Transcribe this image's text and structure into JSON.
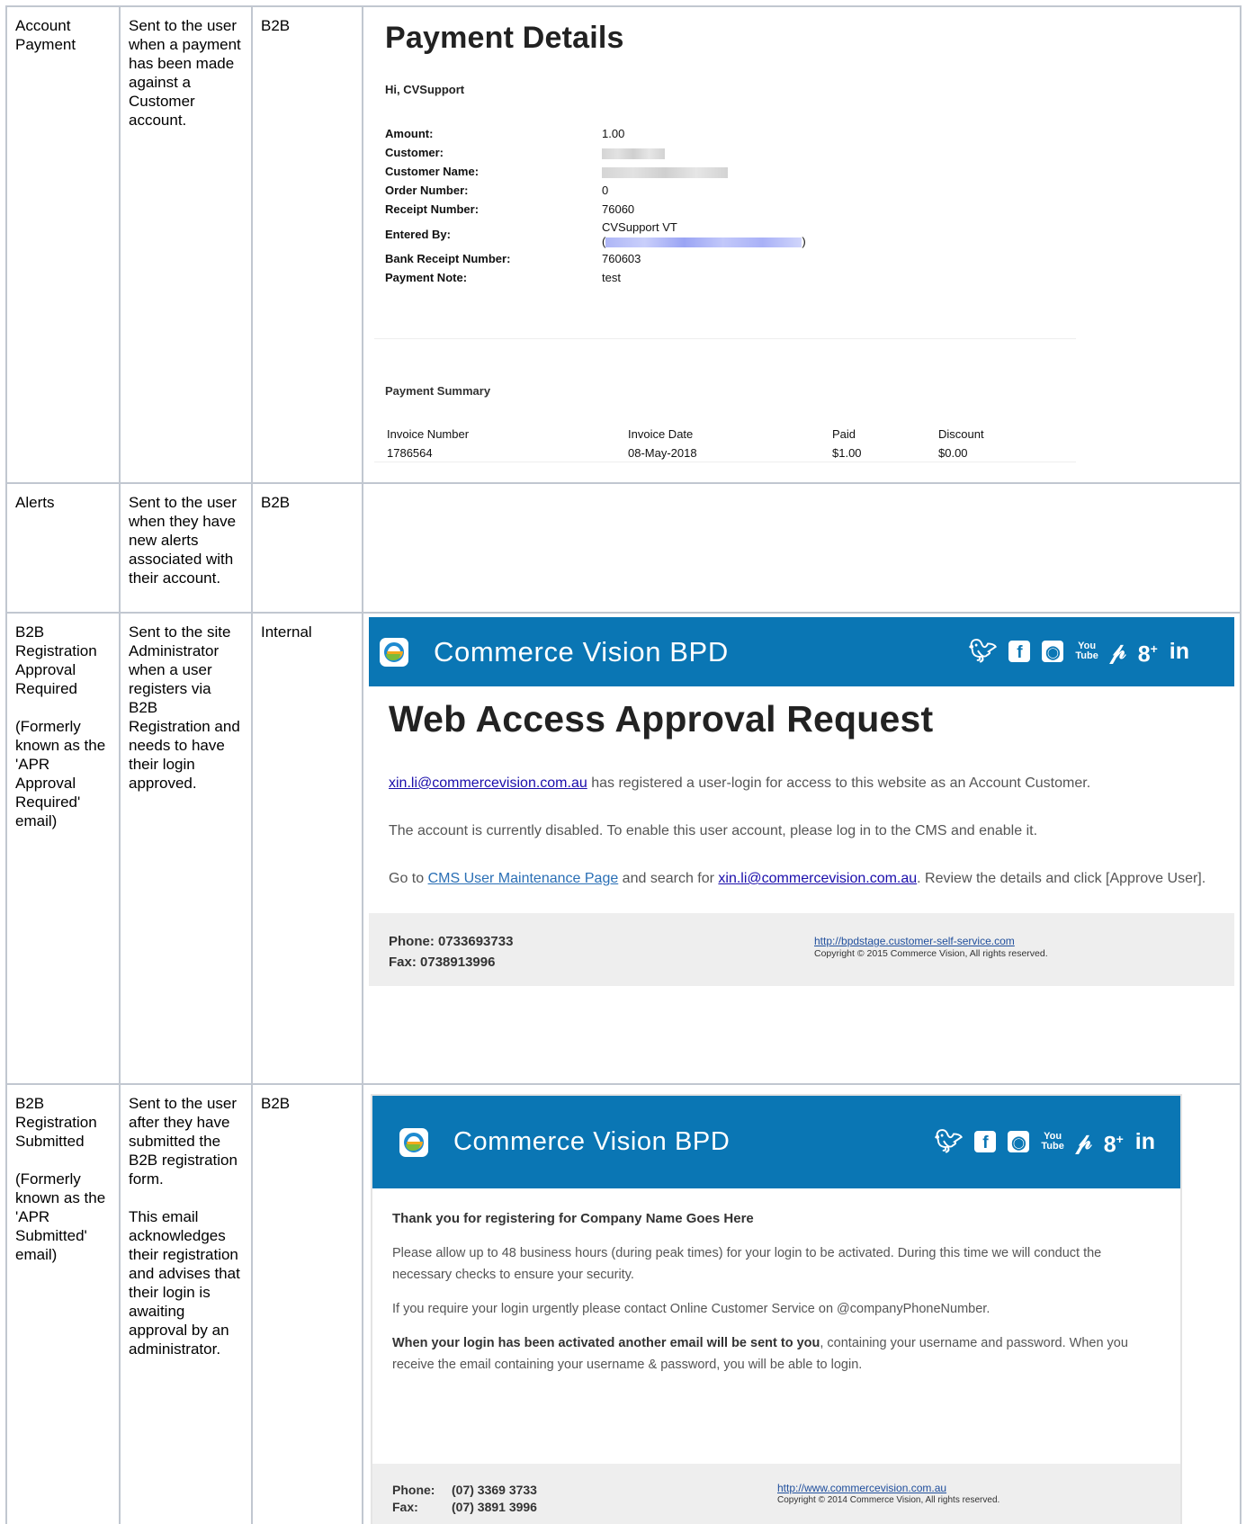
{
  "rows": [
    {
      "name": [
        "Account",
        "Payment"
      ],
      "description": "Sent to the user when a payment has been made against a Customer account.",
      "type": "B2B"
    },
    {
      "name": [
        "Alerts"
      ],
      "description": "Sent to the user when they have new alerts associated with their account.",
      "type": "B2B"
    },
    {
      "name": [
        "B2B Registration Approval Required",
        "(Formerly known as the 'APR Approval Required' email)"
      ],
      "description": "Sent to the site Administrator when a user registers via B2B Registration and needs to have their login approved.",
      "type": "Internal"
    },
    {
      "name": [
        "B2B Registration Submitted",
        "(Formerly known as the 'APR Submitted' email)"
      ],
      "description": [
        "Sent to the user after they have submitted the B2B registration form.",
        "This email acknowledges their registration and advises that their login is awaiting approval by an administrator."
      ],
      "type": "B2B"
    }
  ],
  "payment_email": {
    "title": "Payment Details",
    "greeting": "Hi, CVSupport",
    "fields": [
      {
        "label": "Amount:",
        "value": "1.00"
      },
      {
        "label": "Customer:",
        "value": ""
      },
      {
        "label": "Customer Name:",
        "value": ""
      },
      {
        "label": "Order Number:",
        "value": "0"
      },
      {
        "label": "Receipt Number:",
        "value": "76060"
      },
      {
        "label": "Entered By:",
        "value": "CVSupport VT",
        "value2_prefix": "(",
        "value2_suffix": ")"
      },
      {
        "label": "Bank Receipt Number:",
        "value": "760603"
      },
      {
        "label": "Payment Note:",
        "value": "test"
      }
    ],
    "summary_title": "Payment Summary",
    "summary_headers": [
      "Invoice Number",
      "Invoice Date",
      "Paid",
      "Discount"
    ],
    "summary_rows": [
      [
        "1786564",
        "08-May-2018",
        "$1.00",
        "$0.00"
      ]
    ]
  },
  "approval_email": {
    "brand": "Commerce Vision BPD",
    "title": "Web Access Approval Request",
    "email_link": "xin.li@commercevision.com.au",
    "line1_rest": " has registered a user-login for access to this website as an Account Customer.",
    "line2": "The account is currently disabled. To enable this user account, please log in to the CMS and enable it.",
    "line3_a": "Go to ",
    "cms_link": "CMS User Maintenance Page",
    "line3_b": " and search for ",
    "line3_c": ". Review the details and click [Approve User].",
    "phone": "Phone: 0733693733",
    "fax": "Fax: 0738913996",
    "site_link": "http://bpdstage.customer-self-service.com",
    "copyright": "Copyright © 2015 Commerce Vision, All rights reserved."
  },
  "submitted_email": {
    "brand": "Commerce Vision BPD",
    "lead": "Thank you for registering for Company Name Goes Here",
    "p1": "Please allow up to 48 business hours (during peak times) for your login to be activated. During this time we will conduct the necessary checks to ensure your security.",
    "p2": "If you require your login urgently please contact Online Customer Service on @companyPhoneNumber.",
    "p3_bold": "When your login has been activated another email will be sent to you",
    "p3_rest": ", containing your username and password. When you receive the email containing your username & password, you will be able to login.",
    "phone_label": "Phone:",
    "phone_value": "(07) 3369 3733",
    "fax_label": "Fax:",
    "fax_value": "(07) 3891 3996",
    "site_link": "http://www.commercevision.com.au",
    "copyright": "Copyright © 2014 Commerce Vision, All rights reserved."
  },
  "socials": [
    "twitter-icon",
    "facebook-icon",
    "instagram-icon",
    "youtube-icon",
    "pinterest-icon",
    "google-plus-icon",
    "linkedin-icon"
  ],
  "colors": {
    "banner": "#0a76b4",
    "border": "#c1c7d0",
    "link": "#1a0dab"
  }
}
